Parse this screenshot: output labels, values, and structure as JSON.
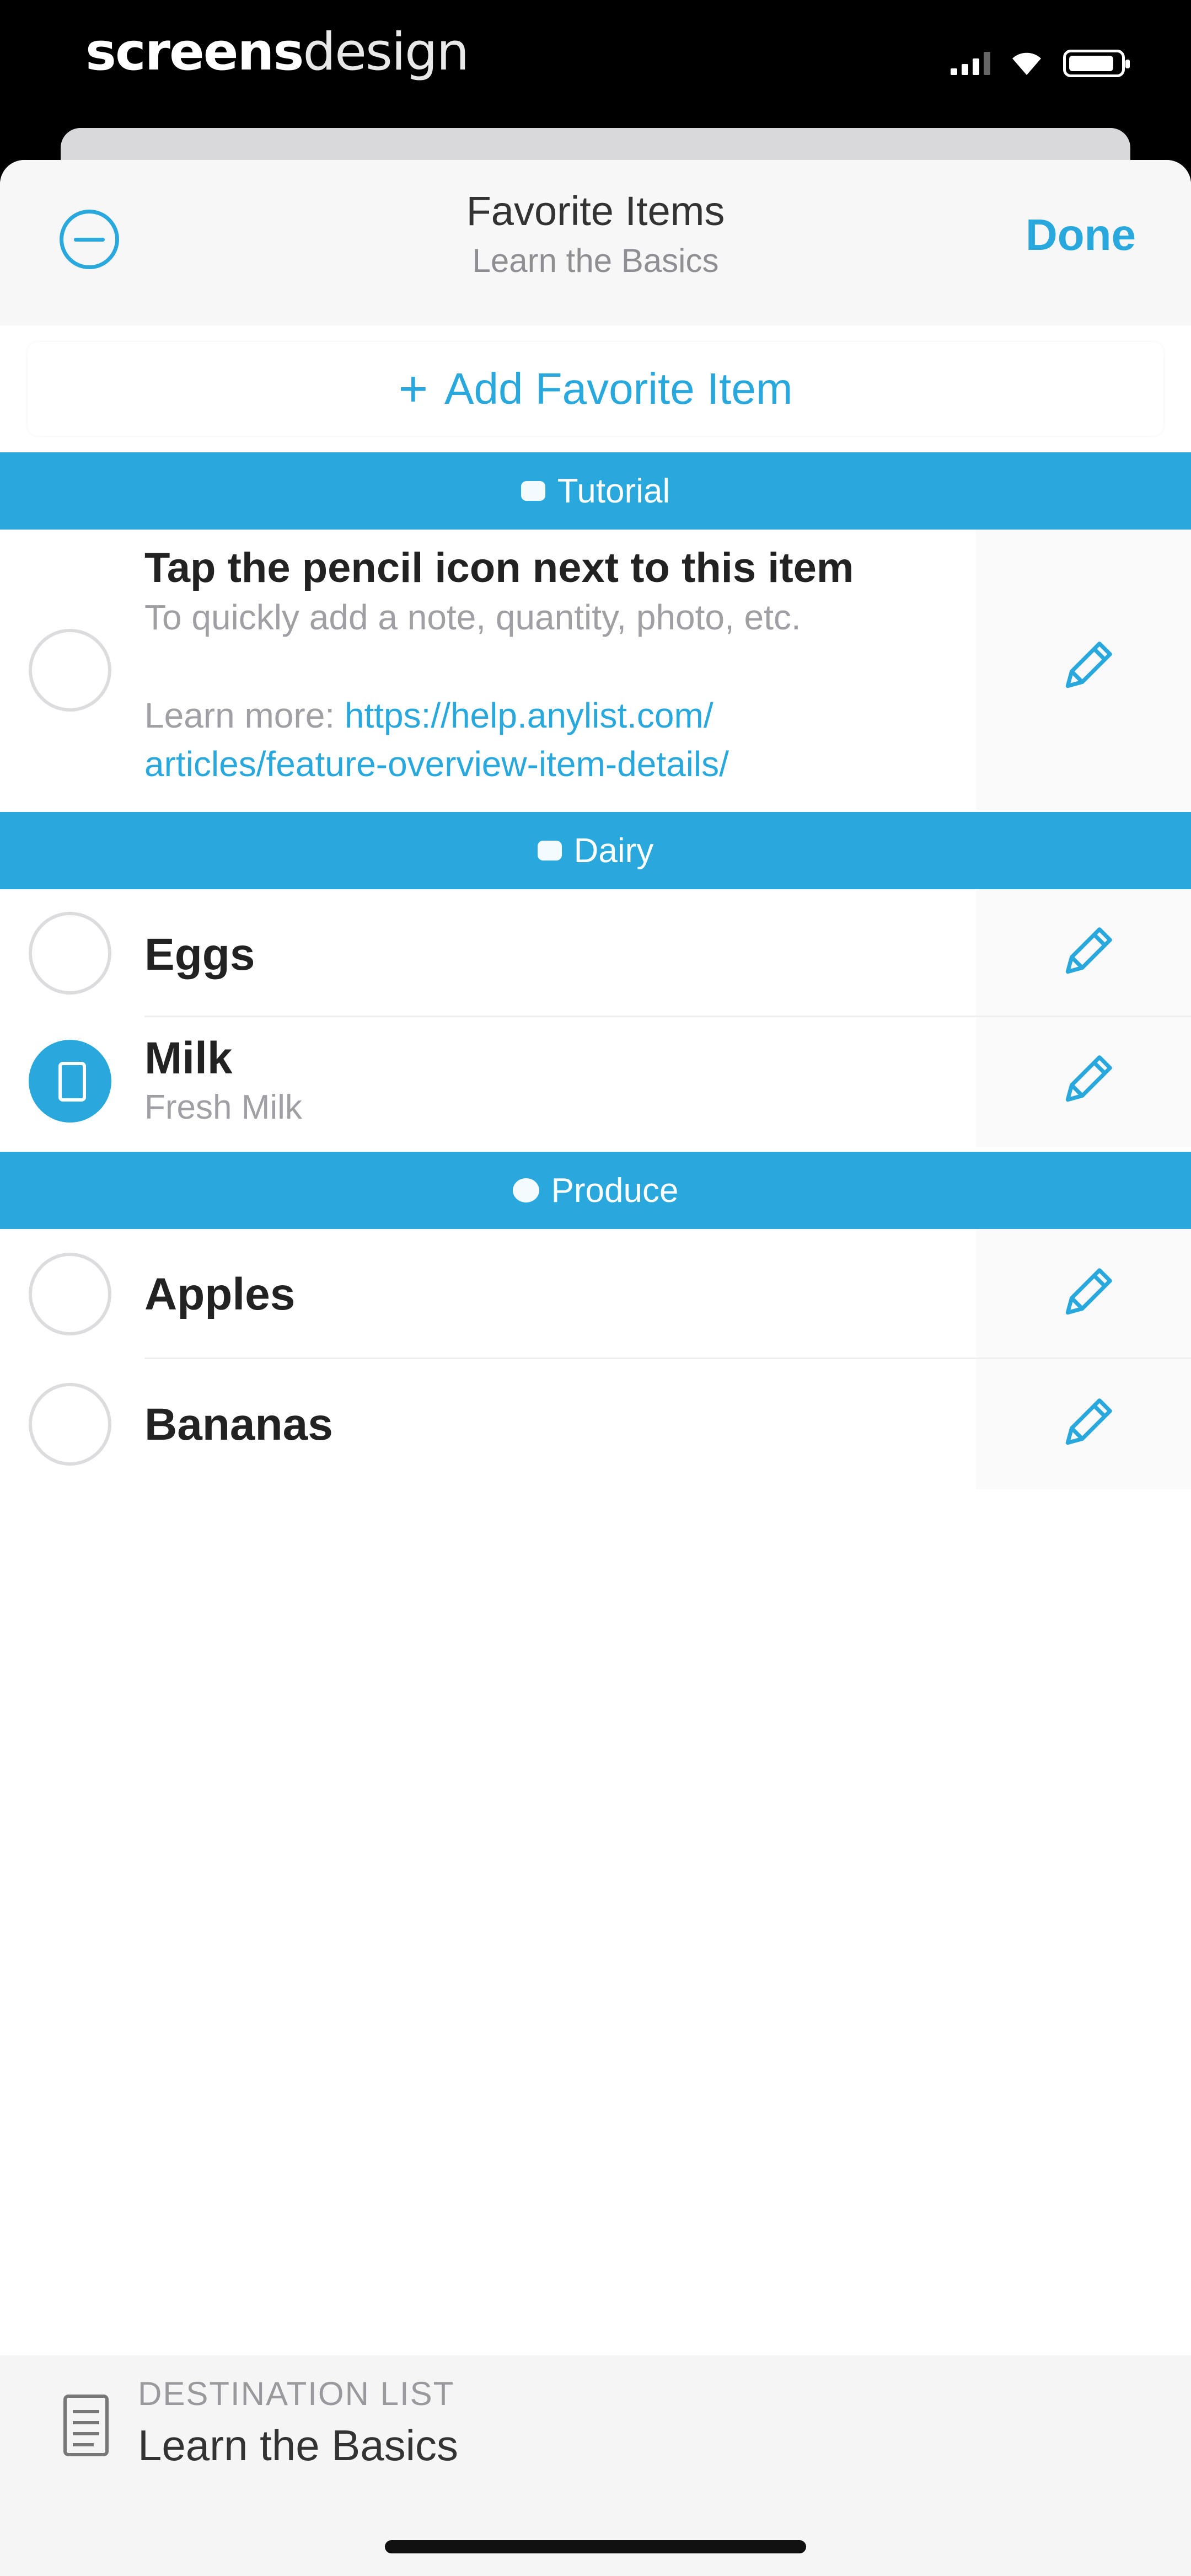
{
  "watermark": {
    "bold": "screens",
    "light": "design"
  },
  "nav": {
    "title": "Favorite Items",
    "subtitle": "Learn the Basics",
    "done_label": "Done"
  },
  "add_button": {
    "plus": "+",
    "label": "Add Favorite Item"
  },
  "sections": {
    "tutorial": {
      "title": "Tutorial"
    },
    "dairy": {
      "title": "Dairy"
    },
    "produce": {
      "title": "Produce"
    }
  },
  "tutorial_item": {
    "title": "Tap the pencil icon next to this item",
    "line1": "To quickly add a note, quantity, photo, etc.",
    "learn_prefix": "Learn more: ",
    "link_part1": "https://help.anylist.com/",
    "link_part2": "articles/feature-overview-item-details/",
    "checked": false
  },
  "items": {
    "eggs": {
      "name": "Eggs",
      "checked": false
    },
    "milk": {
      "name": "Milk",
      "note": "Fresh Milk",
      "checked": true
    },
    "apples": {
      "name": "Apples",
      "checked": false
    },
    "bananas": {
      "name": "Bananas",
      "checked": false
    }
  },
  "destination": {
    "label": "DESTINATION LIST",
    "value": "Learn the Basics"
  },
  "colors": {
    "accent": "#29a8de",
    "background": "#ffffff",
    "status_bar": "#000000"
  },
  "icons": {
    "edit": "minus-circle-icon",
    "pencil": "pencil-icon",
    "category": "category-icon",
    "list": "list-icon"
  }
}
